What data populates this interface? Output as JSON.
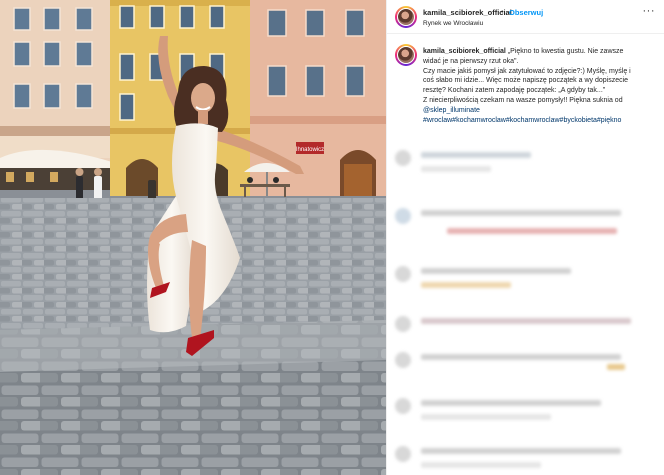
{
  "header": {
    "username": "kamila_scibiorek_official",
    "separator": "•",
    "follow_label": "Obserwuj",
    "location": "Rynek we Wrocławiu",
    "more_label": "···"
  },
  "caption": {
    "username": "kamila_scibiorek_official",
    "lines": [
      "„Piękno to kwestia gustu. Nie zawsze",
      "widać je na pierwszy rzut oka\".",
      "Czy macie jakiś pomysł jak zatytułować to zdjęcie?:) Myślę, myślę i",
      "coś słabo mi idzie... Więc może napiszę początek a wy dopiszecie",
      "resztę? Kochani zatem zapodaję początek: „A gdyby tak...\"",
      "Z niecierpliwością czekam na wasze pomysły!! Piękna suknia od"
    ],
    "mention": "@sklep_illuminate",
    "hashtags": "#wroclaw#kochamwroclaw#kochamwroclaw#byckobieta#piękno"
  },
  "photo": {
    "shop_sign": "Ihnatowicz",
    "colors": {
      "sky": "#b9c4cf",
      "building_left": "#e8cdb7",
      "building_yellow": "#e6c25f",
      "building_pink": "#e6b49a",
      "cobblestone": "#9da3a9",
      "dress": "#f7f1ea",
      "heels": "#b0141f"
    }
  },
  "colors": {
    "follow_blue": "#0095f6",
    "link_blue": "#00376b",
    "text": "#262626",
    "divider": "#efefef"
  }
}
